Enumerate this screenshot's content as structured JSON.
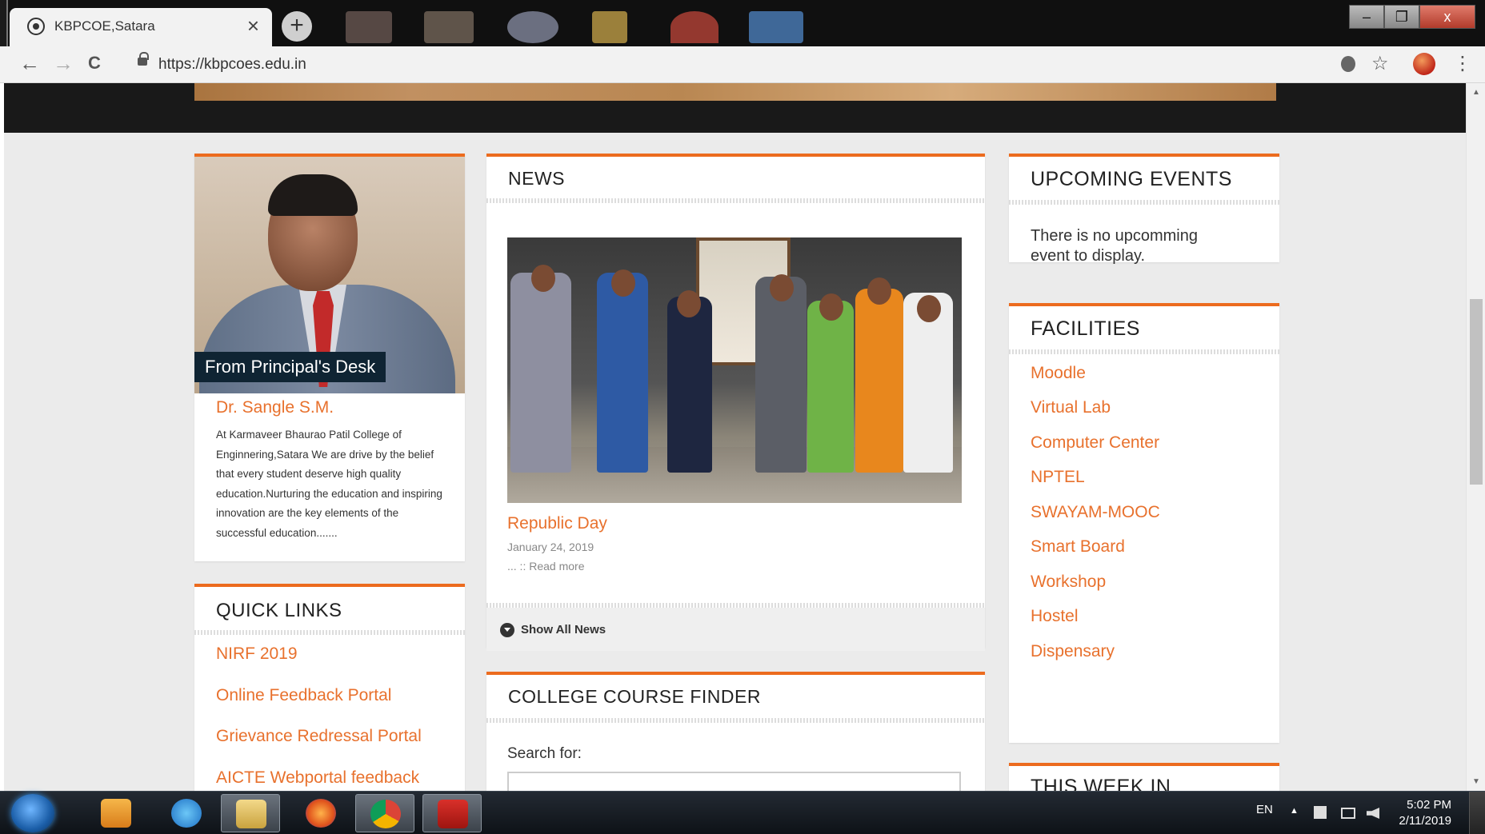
{
  "browser": {
    "tab_title": "KBPCOE,Satara",
    "tab_close": "×",
    "new_tab": "+",
    "url": "https://kbpcoes.edu.in",
    "nav": {
      "back": "←",
      "forward": "→",
      "reload": "C"
    },
    "window_buttons": {
      "minimize": "–",
      "maximize": "❐",
      "close": "x"
    },
    "toolbar": {
      "star": "☆",
      "menu": "⋮"
    }
  },
  "principal": {
    "label": "From Principal's Desk",
    "name": "Dr. Sangle S.M.",
    "text": "At Karmaveer Bhaurao Patil College of Enginnering,Satara We are drive by the belief that every student deserve high quality education.Nurturing the education and inspiring innovation are the key elements of the successful education......."
  },
  "news": {
    "heading": "NEWS",
    "item": {
      "title": "Republic Day",
      "date": "January 24, 2019",
      "more": "... :: Read more"
    },
    "show_all": "Show All News"
  },
  "quick_links": {
    "heading": "QUICK LINKS",
    "items": [
      "NIRF 2019",
      "Online Feedback Portal",
      "Grievance Redressal Portal",
      "AICTE Webportal feedback"
    ]
  },
  "course_finder": {
    "heading": "COLLEGE COURSE FINDER",
    "search_label": "Search for:",
    "search_value": ""
  },
  "events": {
    "heading": "UPCOMING EVENTS",
    "text": "There is no upcomming event to display."
  },
  "facilities": {
    "heading": "FACILITIES",
    "items": [
      "Moodle",
      "Virtual Lab",
      "Computer Center",
      "NPTEL",
      "SWAYAM-MOOC",
      "Smart Board",
      "Workshop",
      "Hostel",
      "Dispensary"
    ]
  },
  "this_week": {
    "heading": "THIS WEEK IN"
  },
  "taskbar": {
    "language": "EN",
    "time": "5:02 PM",
    "date": "2/11/2019"
  },
  "colors": {
    "accent": "#ec6b1e",
    "link": "#e8712d",
    "badge": "#0f2433"
  }
}
